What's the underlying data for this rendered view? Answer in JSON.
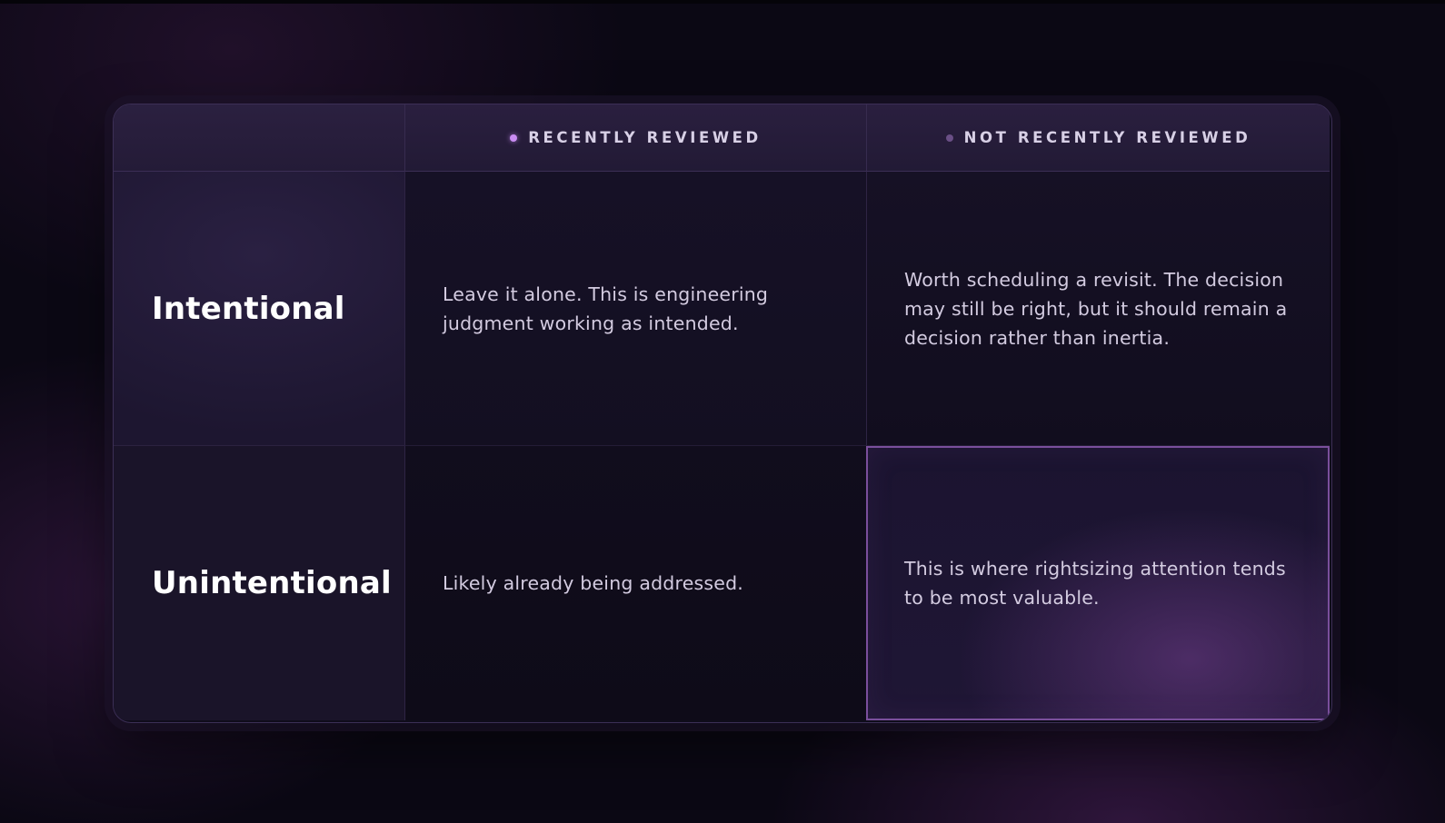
{
  "matrix": {
    "columns": [
      {
        "label": "RECENTLY REVIEWED",
        "dot_color": "#c98cf2"
      },
      {
        "label": "NOT RECENTLY REVIEWED",
        "dot_color": "#6a4f86"
      }
    ],
    "rows": [
      {
        "label": "Intentional",
        "cells": [
          "Leave it alone. This is engineering judgment working as intended.",
          "Worth scheduling a revisit. The decision may still be right, but it should remain a decision rather than inertia."
        ]
      },
      {
        "label": "Unintentional",
        "cells": [
          "Likely already being addressed.",
          "This is where rightsizing attention tends to be most valuable."
        ]
      }
    ],
    "highlight_color": "#7a4f9c",
    "highlighted_cell": "Unintentional / NOT RECENTLY REVIEWED"
  }
}
